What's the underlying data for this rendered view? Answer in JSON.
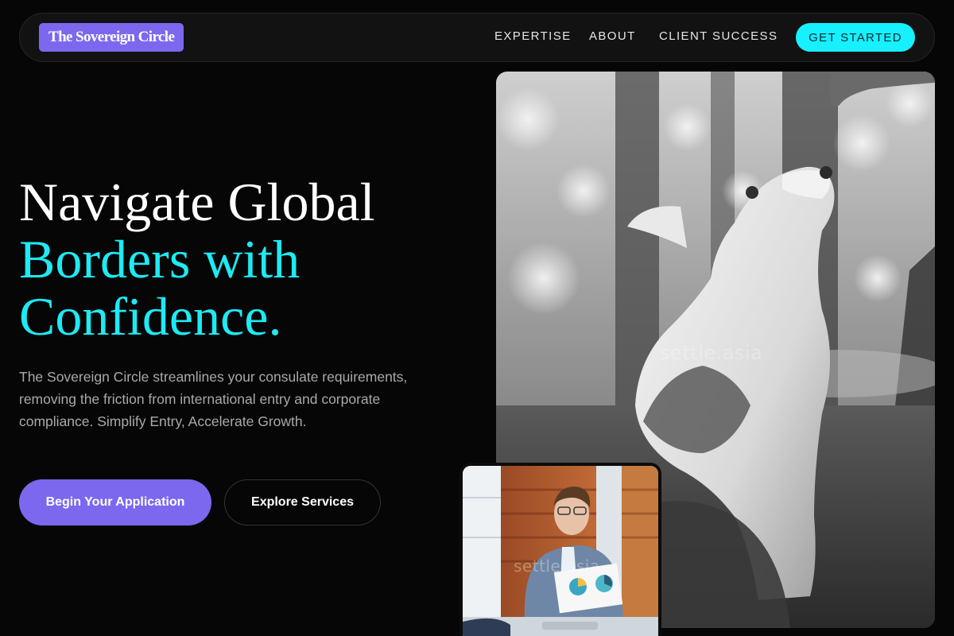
{
  "nav": {
    "brand": "The Sovereign Circle",
    "links": [
      "EXPERTISE",
      "ABOUT",
      "CLIENT SUCCESS"
    ],
    "cta": "GET STARTED"
  },
  "hero": {
    "headline_line1": "Navigate Global",
    "headline_line2": "Borders with",
    "headline_line3": "Confidence.",
    "description": "The Sovereign Circle streamlines your consulate requirements, removing the friction from international entry and corporate compliance. Simplify Entry, Accelerate Growth.",
    "primary_button": "Begin Your Application",
    "secondary_button": "Explore Services"
  },
  "images": {
    "main_watermark": "settle.asia",
    "inset_watermark": "settle.asia"
  },
  "colors": {
    "accent_purple": "#7b68ee",
    "accent_cyan": "#1deaf4",
    "background": "#060606"
  }
}
